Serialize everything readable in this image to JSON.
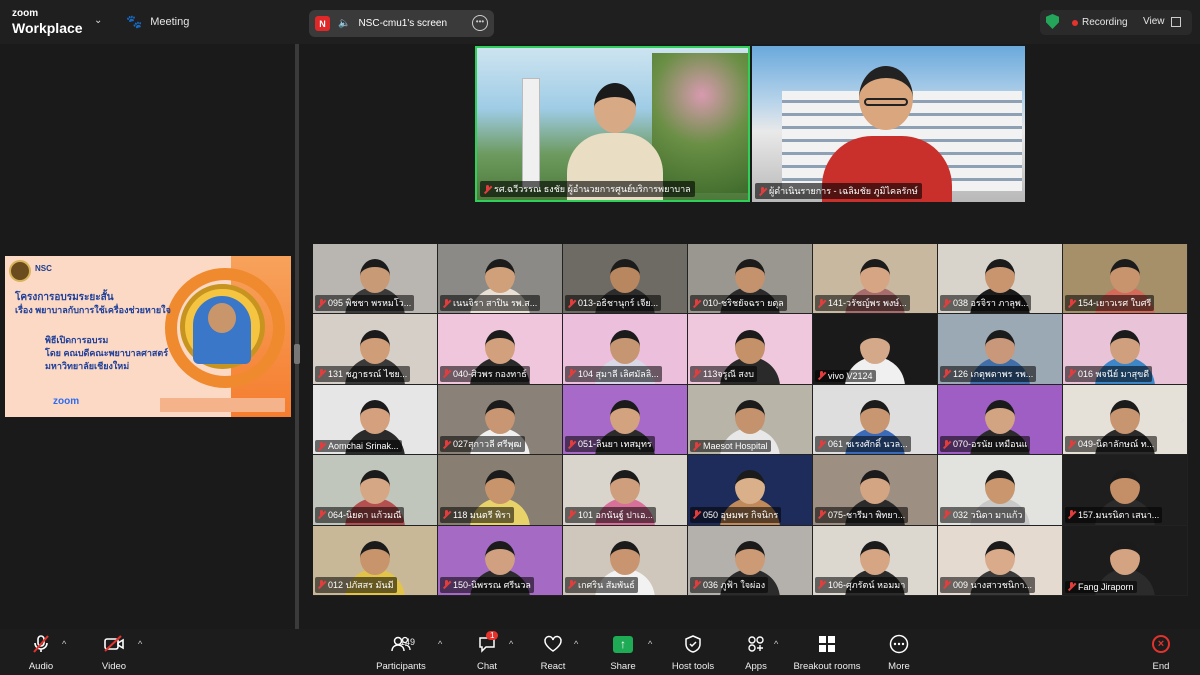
{
  "topbar": {
    "brand_line1": "zoom",
    "brand_line2": "Workplace",
    "meeting_label": "Meeting",
    "share_initial": "N",
    "share_label": "NSC-cmu1's screen",
    "recording_label": "Recording",
    "view_label": "View"
  },
  "slide": {
    "logo_text": "NSC",
    "line1": "โครงการอบรมระยะสั้น",
    "line2": "เรื่อง พยาบาลกับการใช้เครื่องช่วยหายใจ",
    "line3": "พิธีเปิดการอบรม",
    "line4": "โดย คณบดีคณะพยาบาลศาสตร์",
    "line5": "มหาวิทยาลัยเชียงใหม่",
    "zoom_logo": "zoom"
  },
  "speakers": [
    {
      "name": "รศ.ฉวีวรรณ ธงชัย ผู้อำนวยการศูนย์บริการพยาบาล"
    },
    {
      "name": "ผู้ดำเนินรายการ - เฉลิมชัย ภูมิไคลรักษ์"
    }
  ],
  "participants": [
    {
      "name": "095 พิชชา พรหมโว...",
      "bg": "#b9b6b2",
      "skin": "#c89a76",
      "cloth": "#3a3a3a"
    },
    {
      "name": "เนนจิรา สาปิน รพ.ส...",
      "bg": "#8b8a86",
      "skin": "#d0a07a",
      "cloth": "#e8e0d5"
    },
    {
      "name": "013-อธิชานุกร์ เจีย...",
      "bg": "#6e6a64",
      "skin": "#b8875f",
      "cloth": "#2c2c2c"
    },
    {
      "name": "010-ชริชยัจฉรา ยตุล",
      "bg": "#9a9790",
      "skin": "#c4926c",
      "cloth": "#2b2b2b"
    },
    {
      "name": "141-วรัชญ์พร พงษ์...",
      "bg": "#c8b8a0",
      "skin": "#d6a684",
      "cloth": "#a86c6c"
    },
    {
      "name": "038 อรจิรา ภาลุพ...",
      "bg": "#d8d4cc",
      "skin": "#c8956f",
      "cloth": "#1c1c1c"
    },
    {
      "name": "154-เยาวเรศ ใบศรี",
      "bg": "#a5906a",
      "skin": "#c8946e",
      "cloth": "#d56a5a"
    },
    {
      "name": "131 ชฎาธรณ์ ไชย...",
      "bg": "#d5cfc7",
      "skin": "#cf9d78",
      "cloth": "#3a3a3a"
    },
    {
      "name": "040-ศิวพร กองทาธ์",
      "bg": "#efc6dc",
      "skin": "#d2a07c",
      "cloth": "#2a2a2a"
    },
    {
      "name": "104 สุมาลี เลิศมัลลิ...",
      "bg": "#ecc0dc",
      "skin": "#c69672",
      "cloth": "#d8d8e8"
    },
    {
      "name": "113จรูณี สงบ",
      "bg": "#efc8de",
      "skin": "#c49168",
      "cloth": "#2a2a2a"
    },
    {
      "name": "vivo V2124",
      "bg": "#1a1a1a",
      "skin": "#d4a98a",
      "cloth": "#f0f0f0"
    },
    {
      "name": "126 เกตุพดาพร รพ...",
      "bg": "#9ba9b4",
      "skin": "#c9987a",
      "cloth": "#3f6ea8"
    },
    {
      "name": "016 พจนีย์ มาสุขดี",
      "bg": "#e9c3d8",
      "skin": "#d0a07e",
      "cloth": "#3d86c8"
    },
    {
      "name": "Aomchai Srinak...",
      "bg": "#e6e6e6",
      "skin": "#d4a07e",
      "cloth": "#2a2a2a"
    },
    {
      "name": "027สุกาวลี ศรีพุฒ",
      "bg": "#8a8278",
      "skin": "#c89672",
      "cloth": "#f0f0f0"
    },
    {
      "name": "051-ลินยา เทสมุทร",
      "bg": "#a76ac8",
      "skin": "#d3a27e",
      "cloth": "#2b2b2b"
    },
    {
      "name": "Maesot Hospital",
      "bg": "#b9b4a8",
      "skin": "#c4926c",
      "cloth": "#e8e8e8"
    },
    {
      "name": "061 ชเรงศักดิ์ นวล...",
      "bg": "#dedede",
      "skin": "#c89670",
      "cloth": "#3a6ab8"
    },
    {
      "name": "070-อรนัย เหมือนแ",
      "bg": "#9e5ec4",
      "skin": "#d3a482",
      "cloth": "#2b2b2b"
    },
    {
      "name": "049-นิดาลักษณ์ ท...",
      "bg": "#e6e1d8",
      "skin": "#c79570",
      "cloth": "#2b2b2b"
    },
    {
      "name": "064-นิยดา แก้วมณี",
      "bg": "#c0c6bb",
      "skin": "#d6a784",
      "cloth": "#b55050"
    },
    {
      "name": "118 มนตรี พิรา",
      "bg": "#887f72",
      "skin": "#c8946c",
      "cloth": "#e8d36a"
    },
    {
      "name": "101 อกนันฐ์ ปาเอ...",
      "bg": "#d9d4cc",
      "skin": "#cf9e7c",
      "cloth": "#d9709a"
    },
    {
      "name": "050 อุษมพร กิจนิกร",
      "bg": "#1d2c5a",
      "skin": "#d9b08a",
      "cloth": "#c08a5a"
    },
    {
      "name": "075-ชารีมา พิทยา...",
      "bg": "#9d8f82",
      "skin": "#d4a582",
      "cloth": "#2b2b2b"
    },
    {
      "name": "032 วนิดา มาแก้ว",
      "bg": "#e2e2de",
      "skin": "#c9966e",
      "cloth": "#c8c8c8"
    },
    {
      "name": "157.มนรนิตา เสนา...",
      "bg": "#1e1e1e",
      "skin": "#c48e66",
      "cloth": "#2b2b2b"
    },
    {
      "name": "012 ปภัสสร มันมี",
      "bg": "#c8b898",
      "skin": "#c8946c",
      "cloth": "#e3c44a"
    },
    {
      "name": "150-นิพรรณ ศรีนวล",
      "bg": "#a46ac4",
      "skin": "#d0a080",
      "cloth": "#2b2b2b"
    },
    {
      "name": "เกศริน สัมพันธ์",
      "bg": "#cfc7bc",
      "skin": "#c89570",
      "cloth": "#f2f2f2"
    },
    {
      "name": "036 ภูฟ้า ใจผ่อง",
      "bg": "#b4b1ad",
      "skin": "#cc9a74",
      "cloth": "#2b2b2b"
    },
    {
      "name": "106-ศุภรัตน์ หอมมา",
      "bg": "#dcd8d0",
      "skin": "#d6a684",
      "cloth": "#2b2b2b"
    },
    {
      "name": "009 นางสาวชนิกา...",
      "bg": "#e4dad0",
      "skin": "#d9ab8a",
      "cloth": "#3a3a3a"
    },
    {
      "name": "Fang Jiraporn",
      "bg": "#1c1c1c",
      "skin": "#d4a382",
      "cloth": "#2b2b2b"
    }
  ],
  "toolbar": {
    "audio": "Audio",
    "video": "Video",
    "participants": "Participants",
    "participants_count": "149",
    "chat": "Chat",
    "chat_badge": "1",
    "react": "React",
    "share": "Share",
    "host_tools": "Host tools",
    "apps": "Apps",
    "breakout": "Breakout rooms",
    "more": "More",
    "end": "End"
  }
}
